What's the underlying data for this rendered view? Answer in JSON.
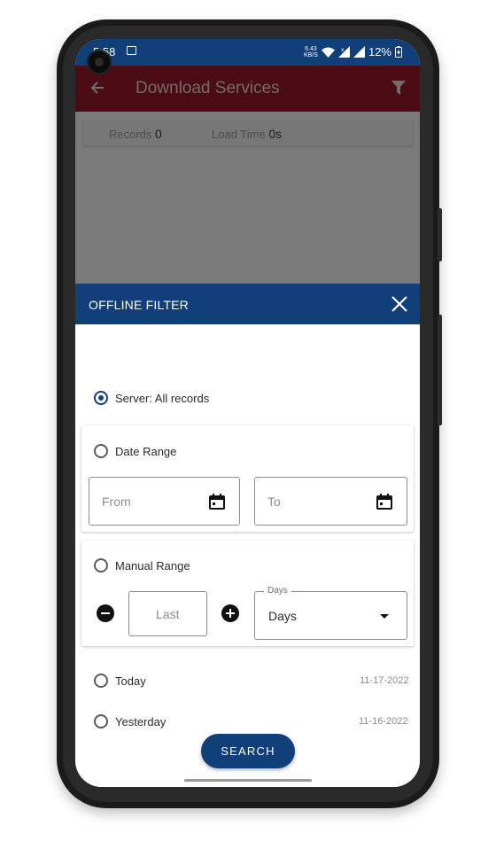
{
  "status_bar": {
    "time": "5:58",
    "net_speed_value": "6.43",
    "net_speed_unit": "KB/S",
    "battery": "12%"
  },
  "app_bar": {
    "title": "Download Services",
    "back_icon": "arrow-left-icon",
    "filter_icon": "funnel-icon"
  },
  "stats": {
    "records_label": "Records",
    "records_value": "0",
    "load_time_label": "Load Time",
    "load_time_value": "0s"
  },
  "filter_sheet": {
    "title": "OFFLINE FILTER",
    "options": {
      "server": {
        "label": "Server: All records",
        "selected": true
      },
      "date_range": {
        "label": "Date Range",
        "selected": false,
        "from_placeholder": "From",
        "to_placeholder": "To"
      },
      "manual_range": {
        "label": "Manual Range",
        "selected": false,
        "last_placeholder": "Last",
        "unit_floating_label": "Days",
        "unit_value": "Days"
      },
      "today": {
        "label": "Today",
        "date": "11-17-2022",
        "selected": false
      },
      "yesterday": {
        "label": "Yesterday",
        "date": "11-16-2022",
        "selected": false
      }
    },
    "search_label": "SEARCH"
  },
  "colors": {
    "primary": "#103f7a",
    "app_bar_dimmed": "#4c0c16",
    "overlay": "#7a7a7a"
  }
}
